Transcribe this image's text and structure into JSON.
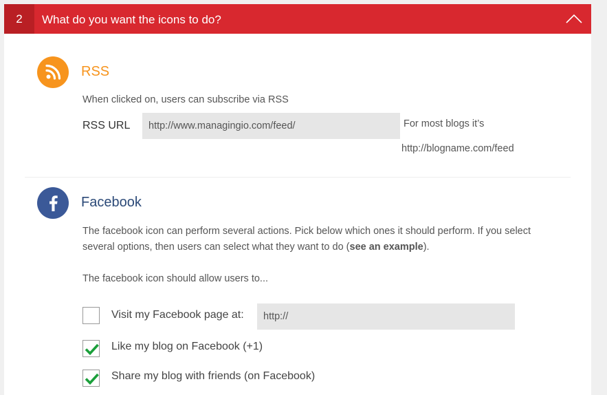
{
  "header": {
    "step_number": "2",
    "title": "What do you want the icons to do?"
  },
  "rss": {
    "icon": "rss-icon",
    "title": "RSS",
    "description": "When clicked on, users can subscribe via RSS",
    "url_label": "RSS URL",
    "url_value": "http://www.managingio.com/feed/",
    "hint_line1": "For most blogs it’s",
    "hint_line2": "http://blogname.com/feed"
  },
  "facebook": {
    "icon": "facebook-icon",
    "title": "Facebook",
    "description_line1": "The facebook icon can perform several actions. Pick below which ones it should perform. If you select",
    "description_line2_prefix": "several options, then users can select what they want to do (",
    "example_link": "see an example",
    "description_line2_suffix": ").",
    "allow_text": "The facebook icon should allow users to...",
    "options": [
      {
        "label": "Visit my Facebook page at:",
        "checked": false,
        "input_value": "http://"
      },
      {
        "label": "Like my blog on Facebook (+1)",
        "checked": true
      },
      {
        "label": "Share my blog with friends (on Facebook)",
        "checked": true
      }
    ]
  },
  "colors": {
    "header_red": "#d8282f",
    "step_red": "#b91f24",
    "rss_orange": "#f7941d",
    "facebook_blue": "#3b5998",
    "check_green": "#1a9f3a"
  }
}
